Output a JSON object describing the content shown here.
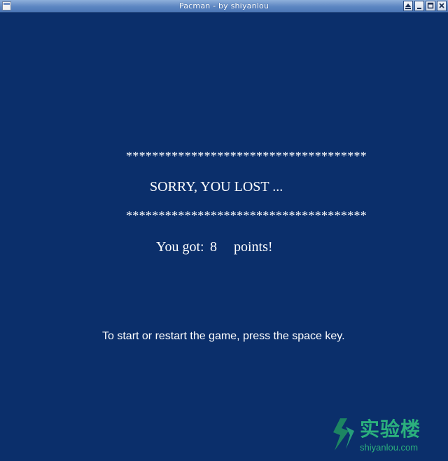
{
  "window": {
    "title": "Pacman - by shiyanlou"
  },
  "game": {
    "stars_top": "*************************************",
    "lost_message": "SORRY, YOU LOST ...",
    "stars_bottom": "*************************************",
    "score_prefix": "You got:",
    "score_value": "8",
    "score_suffix": "points!",
    "instruction": "To start or restart the game, press the space key."
  },
  "watermark": {
    "brand_cn": "实验楼",
    "brand_url": "shiyanlou.com"
  },
  "colors": {
    "background": "#0b2f6b",
    "text": "#ffffff",
    "watermark": "#2bb07d"
  }
}
